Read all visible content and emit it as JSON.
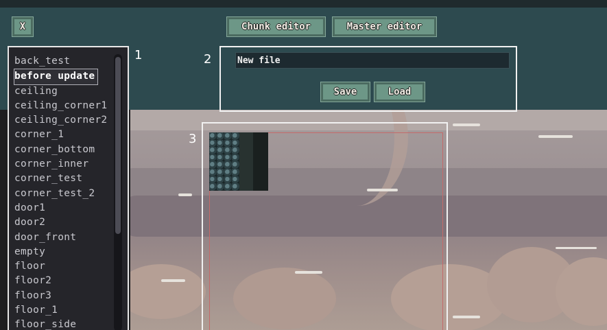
{
  "toolbar": {
    "close_label": "X",
    "chunk_editor_label": "Chunk editor",
    "master_editor_label": "Master editor"
  },
  "file_list": {
    "items": [
      "back_test",
      "before update",
      "ceiling",
      "ceiling_corner1",
      "ceiling_corner2",
      "corner_1",
      "corner_bottom",
      "corner_inner",
      "corner_test",
      "corner_test_2",
      "door1",
      "door2",
      "door_front",
      "empty",
      "floor",
      "floor2",
      "floor3",
      "floor_1",
      "floor_side"
    ],
    "selected": "before update"
  },
  "region_labels": {
    "list": "1",
    "file_panel": "2",
    "chunk": "3"
  },
  "file_panel": {
    "filename_value": "New file",
    "save_label": "Save",
    "load_label": "Load"
  },
  "colors": {
    "toolbar_bg": "#2d4a4f",
    "button_bg": "#6d9787",
    "list_bg": "#25252a",
    "chunk_border": "#c46a6a"
  }
}
